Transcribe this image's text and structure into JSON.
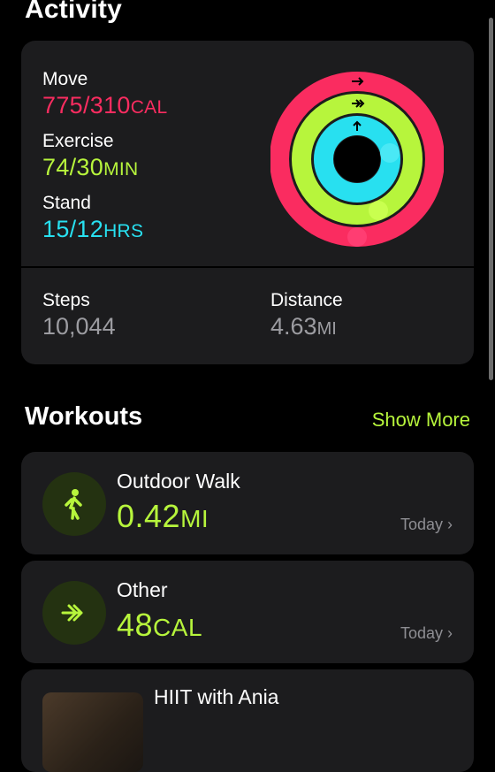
{
  "header": {
    "title": "Activity"
  },
  "activity": {
    "move": {
      "label": "Move",
      "value": "775/310",
      "unit": "CAL",
      "color": "#fa2c60"
    },
    "exercise": {
      "label": "Exercise",
      "value": "74/30",
      "unit": "MIN",
      "color": "#b7f53c"
    },
    "stand": {
      "label": "Stand",
      "value": "15/12",
      "unit": "HRS",
      "color": "#28e0f0"
    },
    "steps": {
      "label": "Steps",
      "value": "10,044"
    },
    "distance": {
      "label": "Distance",
      "value": "4.63",
      "unit": "MI"
    }
  },
  "workouts": {
    "title": "Workouts",
    "show_more": "Show More",
    "items": [
      {
        "name": "Outdoor Walk",
        "value": "0.42",
        "unit": "MI",
        "date": "Today",
        "icon": "walking-figure-icon"
      },
      {
        "name": "Other",
        "value": "48",
        "unit": "CAL",
        "date": "Today",
        "icon": "double-arrow-icon"
      },
      {
        "name": "HIIT with Ania",
        "icon": "video-thumbnail"
      }
    ]
  },
  "colors": {
    "accent": "#b7f53c",
    "card": "#1c1c1e",
    "move": "#fa2c60",
    "exercise": "#b7f53c",
    "stand": "#28e0f0"
  }
}
